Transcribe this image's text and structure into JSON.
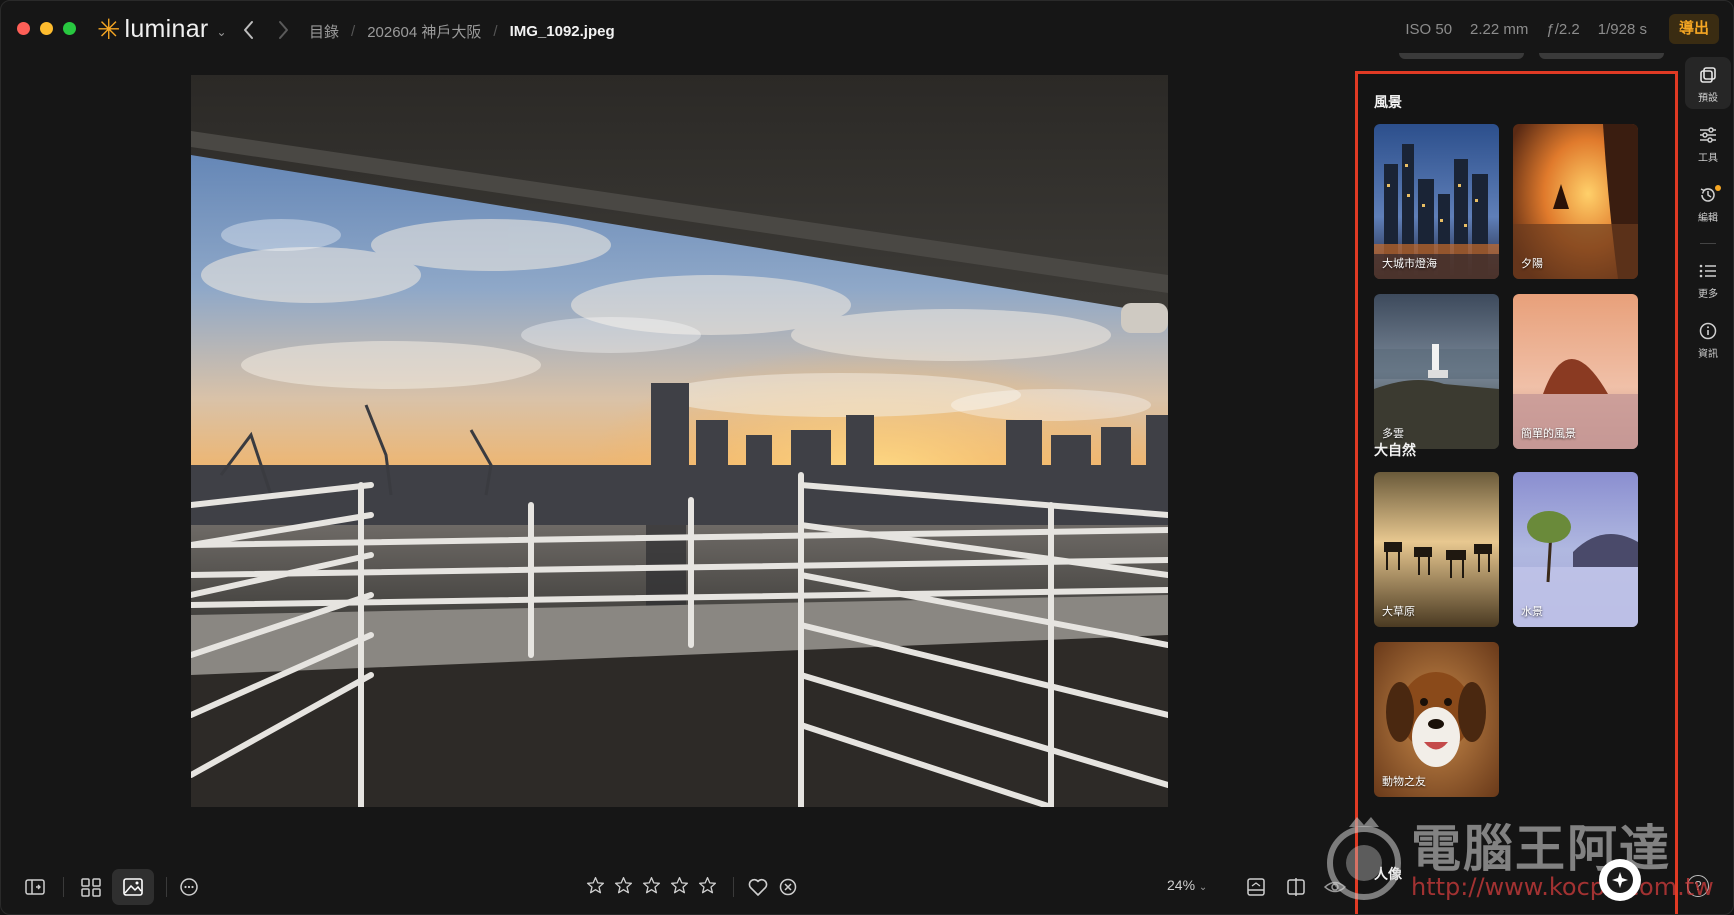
{
  "app": {
    "name": "luminar",
    "logo_icon": "sparkle-logo-icon"
  },
  "breadcrumb": {
    "items": [
      "目錄",
      "202604 神戶大阪"
    ],
    "current": "IMG_1092.jpeg"
  },
  "exif": {
    "iso": "ISO 50",
    "focal": "2.22 mm",
    "aperture": "ƒ/2.2",
    "shutter": "1/928 s"
  },
  "toolbar": {
    "export_label": "導出"
  },
  "presets": {
    "sections": [
      {
        "title": "風景",
        "items": [
          {
            "label": "大城市燈海",
            "thumb": "city-lights"
          },
          {
            "label": "夕陽",
            "thumb": "sunset"
          },
          {
            "label": "多雲",
            "thumb": "cloudy"
          },
          {
            "label": "簡單的風景",
            "thumb": "simple-landscape"
          }
        ]
      },
      {
        "title": "大自然",
        "items": [
          {
            "label": "大草原",
            "thumb": "savanna"
          },
          {
            "label": "水景",
            "thumb": "waterscape"
          },
          {
            "label": "動物之友",
            "thumb": "animal-friends"
          }
        ]
      }
    ],
    "next_section_title": "人像"
  },
  "rail": {
    "items": [
      {
        "label": "預設",
        "icon": "presets-icon",
        "active": true
      },
      {
        "label": "工具",
        "icon": "sliders-icon",
        "active": false
      },
      {
        "label": "編輯",
        "icon": "history-icon",
        "active": false,
        "badge": true
      },
      {
        "label": "更多",
        "icon": "list-icon",
        "active": false
      },
      {
        "label": "資訊",
        "icon": "info-icon",
        "active": false
      }
    ]
  },
  "bottombar": {
    "zoom": "24%",
    "rating_stars": 5,
    "rating_value": 0
  },
  "watermark": {
    "text": "電腦王阿達",
    "url": "http://www.kocpc.com.tw"
  },
  "colors": {
    "accent": "#f5a623",
    "highlight_border": "#e03a24",
    "background": "#161616"
  }
}
